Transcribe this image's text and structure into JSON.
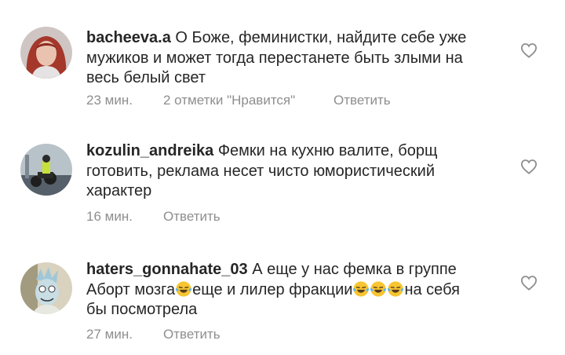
{
  "comments": [
    {
      "username": "bacheeva.a",
      "lines": [
        "О Боже, феминистки, найдите  себе уже",
        "мужиков и может тогда перестанете быть злыми на",
        "весь белый свет"
      ],
      "time": "23 мин.",
      "likes": "2 отметки \"Нравится\"",
      "reply": "Ответить"
    },
    {
      "username": "kozulin_andreika",
      "lines": [
        "Фемки на кухню валите, борщ",
        "готовить, реклама несет чисто юмористический",
        "характер"
      ],
      "time": "16 мин.",
      "reply": "Ответить"
    },
    {
      "username": "haters_gonnahate_03",
      "line1": "А еще у нас фемка в группе",
      "line2a": "Аборт мозга",
      "line2b": "еще и лилер фракции",
      "line2c": "на себя",
      "line3": "бы посмотрела",
      "time": "27 мин.",
      "reply": "Ответить"
    }
  ],
  "icons": {
    "like": "heart-outline-icon",
    "emoji": "face-with-tears-of-joy-emoji"
  },
  "colors": {
    "text": "#262626",
    "meta": "#8e8e8e",
    "heart": "#8e8e8e"
  }
}
